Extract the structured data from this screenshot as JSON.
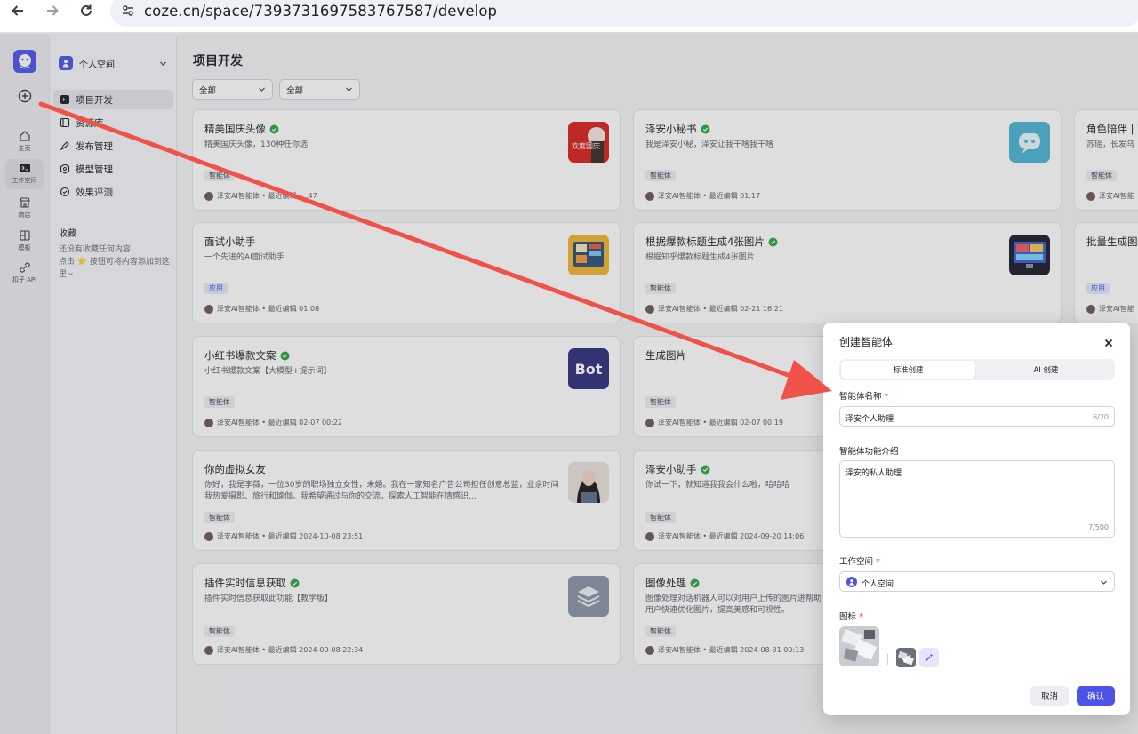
{
  "browser": {
    "url": "coze.cn/space/7393731697583767587/develop"
  },
  "rail": {
    "items": [
      {
        "label": "主页"
      },
      {
        "label": "工作空间"
      },
      {
        "label": "商店"
      },
      {
        "label": "模板"
      },
      {
        "label": "扣子 API"
      }
    ]
  },
  "sidebar": {
    "space_name": "个人空间",
    "nav": [
      {
        "label": "项目开发",
        "icon": "code-icon"
      },
      {
        "label": "资源库",
        "icon": "library-icon"
      },
      {
        "label": "发布管理",
        "icon": "publish-icon"
      },
      {
        "label": "模型管理",
        "icon": "model-icon"
      },
      {
        "label": "效果评测",
        "icon": "evaluate-icon"
      }
    ],
    "favorites_title": "收藏",
    "favorites_empty": "还没有收藏任何内容\n点击 ⭐ 按钮可将内容添加到这里~"
  },
  "main": {
    "title": "项目开发",
    "filters": [
      "全部",
      "全部"
    ],
    "cards": [
      {
        "title": "精美国庆头像",
        "verified": true,
        "desc": "精美国庆头像，130种任你选",
        "tag": "智能体",
        "meta": "泽安AI智能体 • 最近编辑 ...:47"
      },
      {
        "title": "泽安小秘书",
        "verified": true,
        "desc": "我是泽安小秘，泽安让我干啥我干啥",
        "tag": "智能体",
        "meta": "泽安AI智能体 • 最近编辑 01:17"
      },
      {
        "title": "角色陪伴 | 苏",
        "verified": false,
        "desc": "苏瑶，长发乌",
        "tag": "智能体",
        "meta": "泽安AI智能"
      },
      {
        "title": "面试小助手",
        "verified": false,
        "desc": "一个先进的AI面试助手",
        "tag": "应用",
        "meta": "泽安AI智能体 • 最近编辑 01:08"
      },
      {
        "title": "根据爆款标题生成4张图片",
        "verified": true,
        "desc": "根据知乎爆款标题生成4张图片",
        "tag": "智能体",
        "meta": "泽安AI智能体 • 最近编辑 02-21 16:21"
      },
      {
        "title": "批量生成图片",
        "verified": false,
        "desc": "",
        "tag": "应用",
        "meta": "泽安AI智能"
      },
      {
        "title": "小红书爆款文案",
        "verified": true,
        "desc": "小红书爆款文案【大模型+提示词】",
        "tag": "智能体",
        "meta": "泽安AI智能体 • 最近编辑 02-07 00:22"
      },
      {
        "title": "生成图片",
        "verified": false,
        "desc": "",
        "tag": "智能体",
        "meta": "泽安AI智能体 • 最近编辑 02-07 00:19"
      },
      {
        "title": "你的虚拟女友",
        "verified": false,
        "desc": "你好，我是李薇，一位30岁的职场独立女性，未婚。我在一家知名广告公司担任创意总监，业余时间我热爱摄影、旅行和瑜伽。我希望通过与你的交流，探索人工智能在情感识...",
        "tag": "智能体",
        "meta": "泽安AI智能体 • 最近编辑 2024-10-08 23:51"
      },
      {
        "title": "泽安小助手",
        "verified": true,
        "desc": "你试一下，就知道我我会什么啦，哈哈哈",
        "tag": "智能体",
        "meta": "泽安AI智能体 • 最近编辑 2024-09-20 14:06"
      },
      {
        "title": "插件实时信息获取",
        "verified": true,
        "desc": "插件实时信息获取此功能【教学版】",
        "tag": "智能体",
        "meta": "泽安AI智能体 • 最近编辑 2024-09-08 22:34"
      },
      {
        "title": "图像处理",
        "verified": true,
        "desc": "图像处理对话机器人可以对用户上传的图片进帮助用户快速优化图片，提高美感和可视性。",
        "tag": "智能体",
        "meta": "泽安AI智能体 • 最近编辑 2024-08-31 00:13"
      }
    ],
    "bot_thumb_text": "Bot",
    "avatar_thumb_text": "欢度国庆"
  },
  "modal": {
    "title": "创建智能体",
    "tabs": [
      "标准创建",
      "AI 创建"
    ],
    "name_label": "智能体名称",
    "name_value": "泽安个人助理",
    "name_count": "6/20",
    "desc_label": "智能体功能介绍",
    "desc_value": "泽安的私人助理",
    "desc_count": "7/500",
    "workspace_label": "工作空间",
    "workspace_value": "个人空间",
    "icon_label": "图标",
    "cancel": "取消",
    "confirm": "确认"
  },
  "colors": {
    "brand": "#4d53e8",
    "annotation_arrow": "#f0524a"
  }
}
